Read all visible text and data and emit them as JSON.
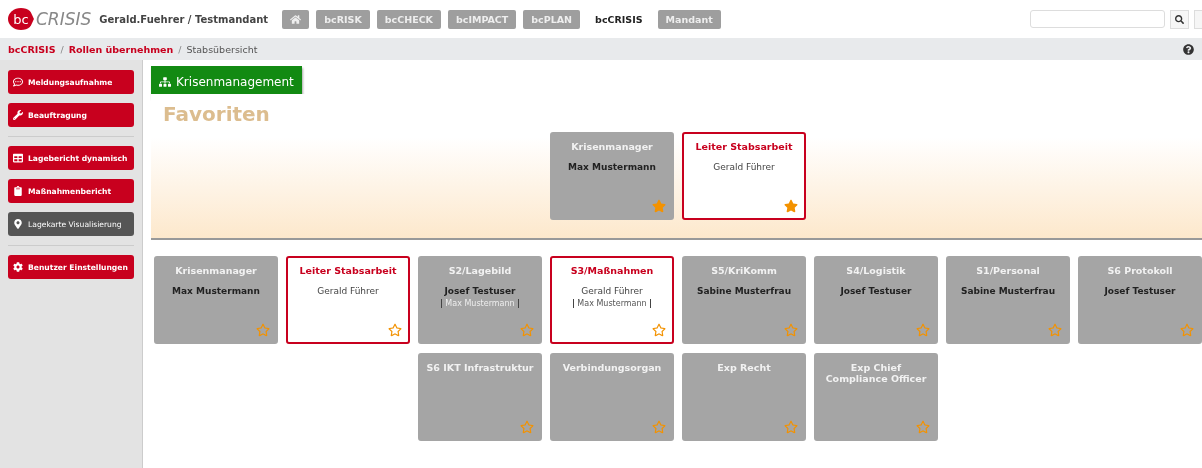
{
  "header": {
    "logo_badge": "bc",
    "logo_text": "CRISIS",
    "user": "Gerald.Fuehrer / Testmandant",
    "nav": [
      {
        "kind": "home",
        "selected": false
      },
      {
        "kind": "text",
        "label": "bcRISK",
        "selected": false
      },
      {
        "kind": "text",
        "label": "bcCHECK",
        "selected": false
      },
      {
        "kind": "text",
        "label": "bcIMPACT",
        "selected": false
      },
      {
        "kind": "text",
        "label": "bcPLAN",
        "selected": false
      },
      {
        "kind": "text",
        "label": "bcCRISIS",
        "selected": true
      },
      {
        "kind": "text",
        "label": "Mandant",
        "selected": false
      }
    ]
  },
  "breadcrumb": {
    "separator": "/",
    "items": [
      {
        "label": "bcCRISIS",
        "link": true
      },
      {
        "label": "Rollen übernehmen",
        "link": true
      },
      {
        "label": "Stabsübersicht",
        "link": false
      }
    ]
  },
  "sidebar": {
    "groups": [
      [
        {
          "label": "Meldungsaufnahme",
          "kind": "primary"
        },
        {
          "label": "Beauftragung",
          "kind": "primary"
        }
      ],
      [
        {
          "label": "Lagebericht dynamisch",
          "kind": "primary"
        },
        {
          "label": "Maßnahmenbericht",
          "kind": "primary"
        },
        {
          "label": "Lagekarte Visualisierung",
          "kind": "secondary"
        }
      ],
      [
        {
          "label": "Benutzer Einstellungen",
          "kind": "primary"
        }
      ]
    ]
  },
  "main": {
    "org_button": "Krisenmanagement",
    "favorites_title": "Favoriten",
    "favorites": [
      {
        "role": "Krisenmanager",
        "person": "Max Mustermann",
        "active": false,
        "favorite": true
      },
      {
        "role": "Leiter Stabsarbeit",
        "person": "Gerald Führer",
        "active": true,
        "favorite": true
      }
    ],
    "role_rows": [
      [
        {
          "role": "Krisenmanager",
          "person": "Max Mustermann",
          "active": false,
          "favorite": false
        },
        {
          "role": "Leiter Stabsarbeit",
          "person": "Gerald Führer",
          "active": true,
          "favorite": false
        },
        {
          "role": "S2/Lagebild",
          "person": "Josef Testuser",
          "deputy": "Max Mustermann",
          "active": false,
          "favorite": false
        },
        {
          "role": "S3/Maßnahmen",
          "person": "Gerald Führer",
          "deputy": "Max Mustermann",
          "active": true,
          "favorite": false
        },
        {
          "role": "S5/KriKomm",
          "person": "Sabine Musterfrau",
          "active": false,
          "favorite": false
        },
        {
          "role": "S4/Logistik",
          "person": "Josef Testuser",
          "active": false,
          "favorite": false
        },
        {
          "role": "S1/Personal",
          "person": "Sabine Musterfrau",
          "active": false,
          "favorite": false
        },
        {
          "role": "S6 Protokoll",
          "person": "Josef Testuser",
          "active": false,
          "favorite": false
        }
      ],
      [
        {
          "role": "S6 IKT Infrastruktur",
          "active": false,
          "favorite": false
        },
        {
          "role": "Verbindungsorgan",
          "active": false,
          "favorite": false
        },
        {
          "role": "Exp Recht",
          "active": false,
          "favorite": false
        },
        {
          "role": "Exp Chief Compliance Officer",
          "active": false,
          "favorite": false
        }
      ]
    ]
  }
}
